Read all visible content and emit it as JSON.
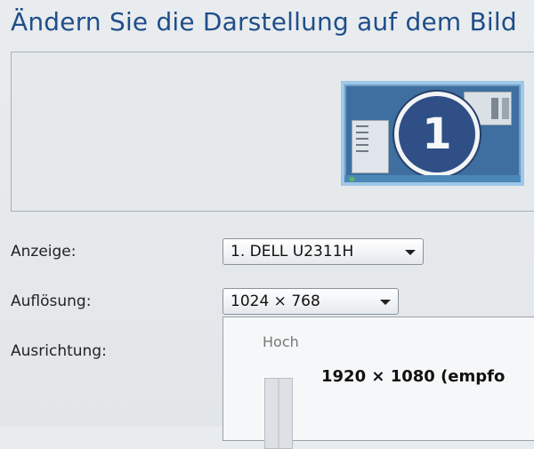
{
  "header": {
    "title": "Ändern Sie die Darstellung auf dem Bild"
  },
  "preview": {
    "monitor_number": "1"
  },
  "display": {
    "label": "Anzeige:",
    "value": "1. DELL U2311H"
  },
  "resolution": {
    "label": "Auflösung:",
    "value": "1024 × 768"
  },
  "orientation": {
    "label": "Ausrichtung:"
  },
  "resolution_dropdown": {
    "orientation_label": "Hoch",
    "option": "1920 × 1080 (empfo"
  }
}
